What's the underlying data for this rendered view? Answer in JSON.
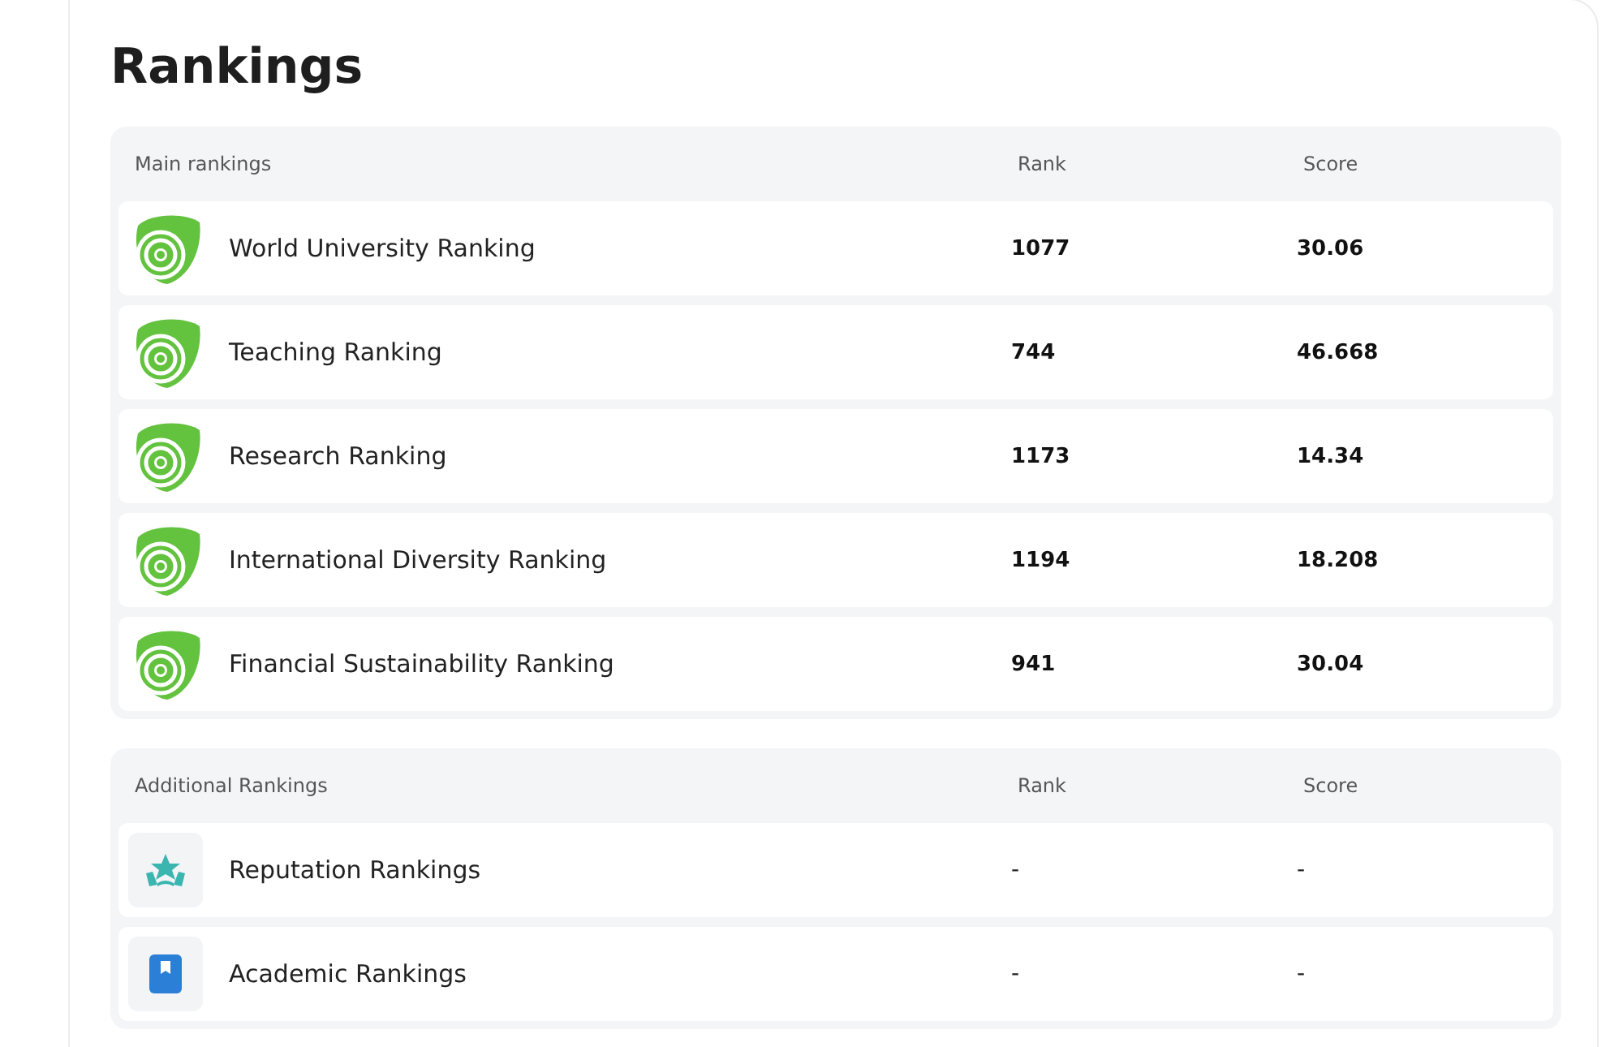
{
  "title": "Rankings",
  "sections": [
    {
      "heading": "Main rankings",
      "rank_label": "Rank",
      "score_label": "Score",
      "rows": [
        {
          "kind": "logo",
          "name": "World University Ranking",
          "rank": "1077",
          "score": "30.06"
        },
        {
          "kind": "logo",
          "name": "Teaching Ranking",
          "rank": "744",
          "score": "46.668"
        },
        {
          "kind": "logo",
          "name": "Research Ranking",
          "rank": "1173",
          "score": "14.34"
        },
        {
          "kind": "logo",
          "name": "International Diversity Ranking",
          "rank": "1194",
          "score": "18.208"
        },
        {
          "kind": "logo",
          "name": "Financial Sustainability Ranking",
          "rank": "941",
          "score": "30.04"
        }
      ]
    },
    {
      "heading": "Additional Rankings",
      "rank_label": "Rank",
      "score_label": "Score",
      "rows": [
        {
          "kind": "stars",
          "name": "Reputation Rankings",
          "rank": "-",
          "score": "-"
        },
        {
          "kind": "book",
          "name": "Academic Rankings",
          "rank": "-",
          "score": "-"
        }
      ]
    }
  ]
}
